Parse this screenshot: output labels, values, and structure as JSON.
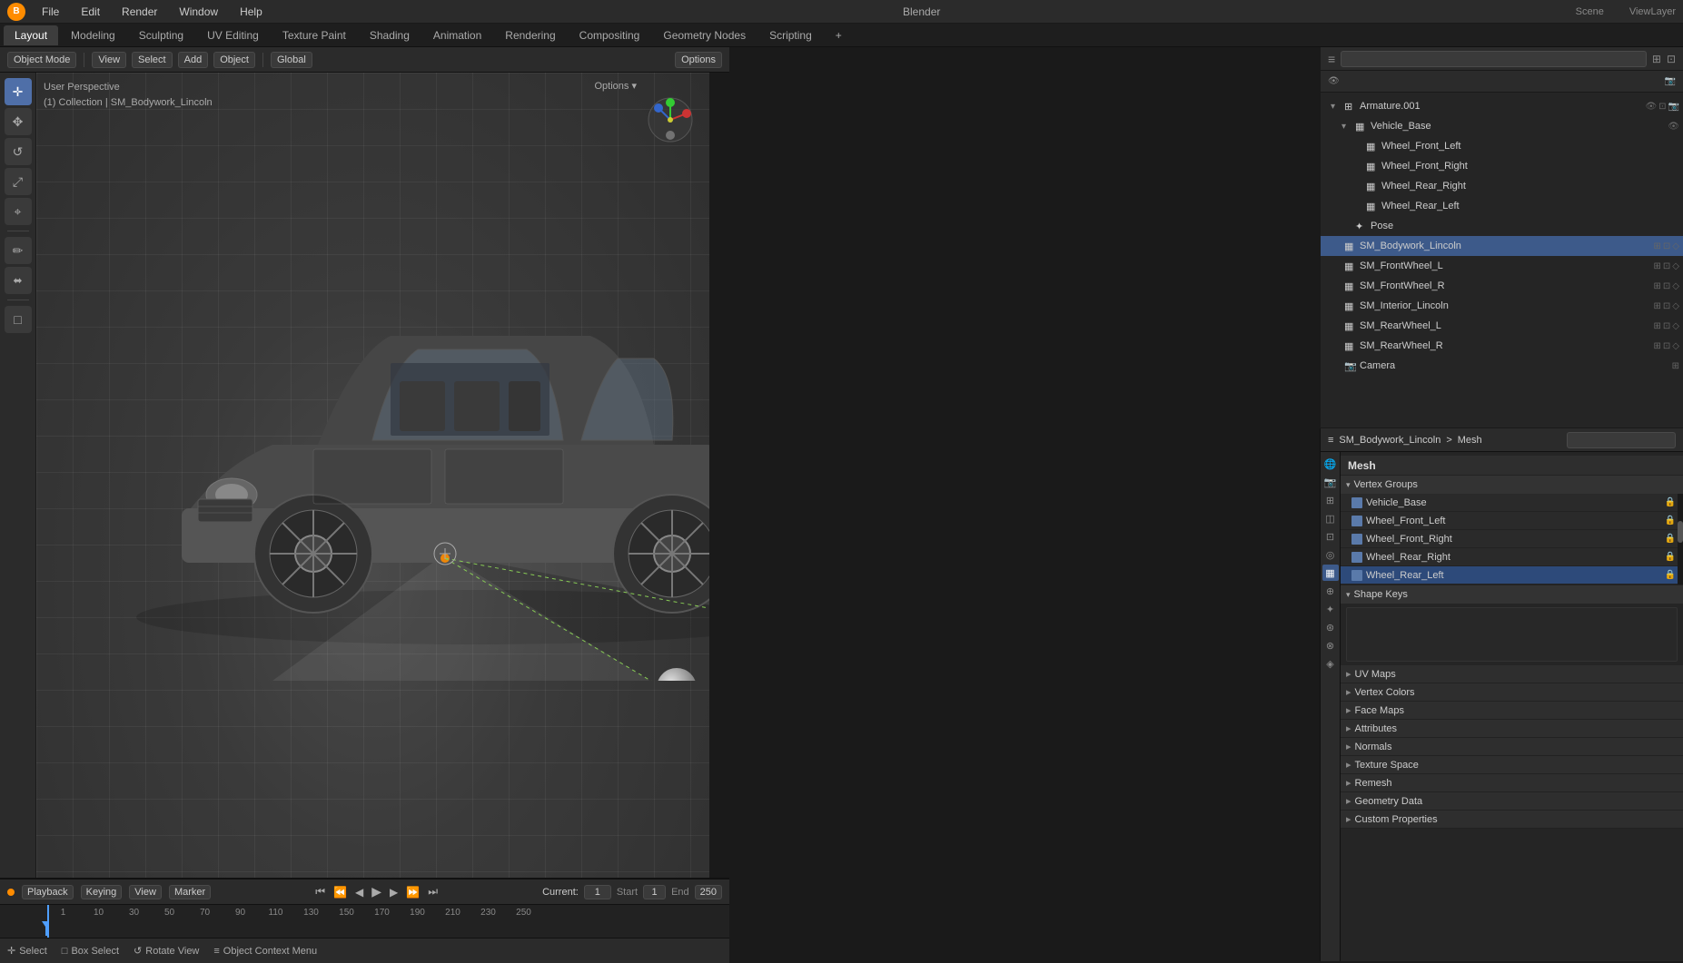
{
  "window": {
    "title": "Blender"
  },
  "top_menu": {
    "items": [
      "File",
      "Edit",
      "Render",
      "Window",
      "Help"
    ]
  },
  "workspace_tabs": {
    "tabs": [
      "Layout",
      "Modeling",
      "Sculpting",
      "UV Editing",
      "Texture Paint",
      "Shading",
      "Animation",
      "Rendering",
      "Compositing",
      "Geometry Nodes",
      "Scripting"
    ],
    "active": "Layout",
    "add_label": "+"
  },
  "header_toolbar": {
    "mode": "Object Mode",
    "view": "View",
    "select": "Select",
    "add": "Add",
    "object": "Object",
    "transform": "Global",
    "options": "Options"
  },
  "viewport": {
    "label_line1": "User Perspective",
    "label_line2": "(1) Collection | SM_Bodywork_Lincoln"
  },
  "outliner": {
    "header_label": "",
    "search_placeholder": "",
    "items": [
      {
        "depth": 0,
        "icon": "▾",
        "type": "armature",
        "label": "Armature.001",
        "expanded": true
      },
      {
        "depth": 1,
        "icon": "▾",
        "type": "mesh",
        "label": "Vehicle_Base",
        "expanded": true
      },
      {
        "depth": 2,
        "icon": " ",
        "type": "mesh",
        "label": "Wheel_Front_Left"
      },
      {
        "depth": 2,
        "icon": " ",
        "type": "mesh",
        "label": "Wheel_Front_Right"
      },
      {
        "depth": 2,
        "icon": " ",
        "type": "mesh",
        "label": "Wheel_Rear_Right"
      },
      {
        "depth": 2,
        "icon": " ",
        "type": "mesh",
        "label": "Wheel_Rear_Left"
      },
      {
        "depth": 1,
        "icon": " ",
        "type": "pose",
        "label": "Pose"
      },
      {
        "depth": 0,
        "icon": " ",
        "type": "mesh",
        "label": "SM_Bodywork_Lincoln",
        "selected": true
      },
      {
        "depth": 0,
        "icon": " ",
        "type": "mesh",
        "label": "SM_FrontWheel_L"
      },
      {
        "depth": 0,
        "icon": " ",
        "type": "mesh",
        "label": "SM_FrontWheel_R"
      },
      {
        "depth": 0,
        "icon": " ",
        "type": "mesh",
        "label": "SM_Interior_Lincoln"
      },
      {
        "depth": 0,
        "icon": " ",
        "type": "mesh",
        "label": "SM_RearWheel_L"
      },
      {
        "depth": 0,
        "icon": " ",
        "type": "mesh",
        "label": "SM_RearWheel_R"
      },
      {
        "depth": 0,
        "icon": " ",
        "type": "camera",
        "label": "Camera"
      }
    ]
  },
  "properties": {
    "breadcrumb": [
      "SM_Bodywork_Lincoln",
      ">",
      "Mesh"
    ],
    "mesh_label": "Mesh",
    "sections": {
      "vertex_groups": {
        "label": "Vertex Groups",
        "items": [
          {
            "name": "Vehicle_Base",
            "active": false
          },
          {
            "name": "Wheel_Front_Left",
            "active": false
          },
          {
            "name": "Wheel_Front_Right",
            "active": false
          },
          {
            "name": "Wheel_Rear_Right",
            "active": false
          },
          {
            "name": "Wheel_Rear_Left",
            "active": true
          }
        ]
      },
      "shape_keys": {
        "label": "Shape Keys"
      },
      "uv_maps": {
        "label": "UV Maps"
      },
      "vertex_colors": {
        "label": "Vertex Colors"
      },
      "face_maps": {
        "label": "Face Maps"
      },
      "attributes": {
        "label": "Attributes"
      },
      "normals": {
        "label": "Normals"
      },
      "texture_space": {
        "label": "Texture Space"
      },
      "remesh": {
        "label": "Remesh"
      },
      "geometry_data": {
        "label": "Geometry Data"
      },
      "custom_properties": {
        "label": "Custom Properties"
      }
    }
  },
  "timeline": {
    "playback_label": "Playback",
    "keying_label": "Keying",
    "view_label": "View",
    "marker_label": "Marker",
    "current_frame": "1",
    "start_label": "Start",
    "start_value": "1",
    "end_label": "End",
    "end_value": "250",
    "frame_numbers": [
      "1",
      "10",
      "30",
      "50",
      "70",
      "90",
      "110",
      "130",
      "150",
      "170",
      "190",
      "210",
      "230",
      "250"
    ]
  },
  "footer": {
    "select_label": "Select",
    "box_select_label": "Box Select",
    "rotate_view_label": "Rotate View",
    "context_menu_label": "Object Context Menu"
  },
  "icons": {
    "mesh": "▦",
    "armature": "⊞",
    "camera": "📷",
    "pose": "✦",
    "expand": "▾",
    "collapse": "▸",
    "lock": "🔒",
    "eye": "👁",
    "cursor": "✛",
    "move": "✥",
    "rotate": "↺",
    "scale": "⤢",
    "transform": "⌖",
    "annotate": "✏",
    "measure": "📐",
    "play": "▶",
    "pause": "⏸",
    "skip_start": "⏮",
    "skip_end": "⏭",
    "prev_frame": "◀",
    "next_frame": "▶",
    "jump_start": "⏪",
    "jump_end": "⏩"
  }
}
